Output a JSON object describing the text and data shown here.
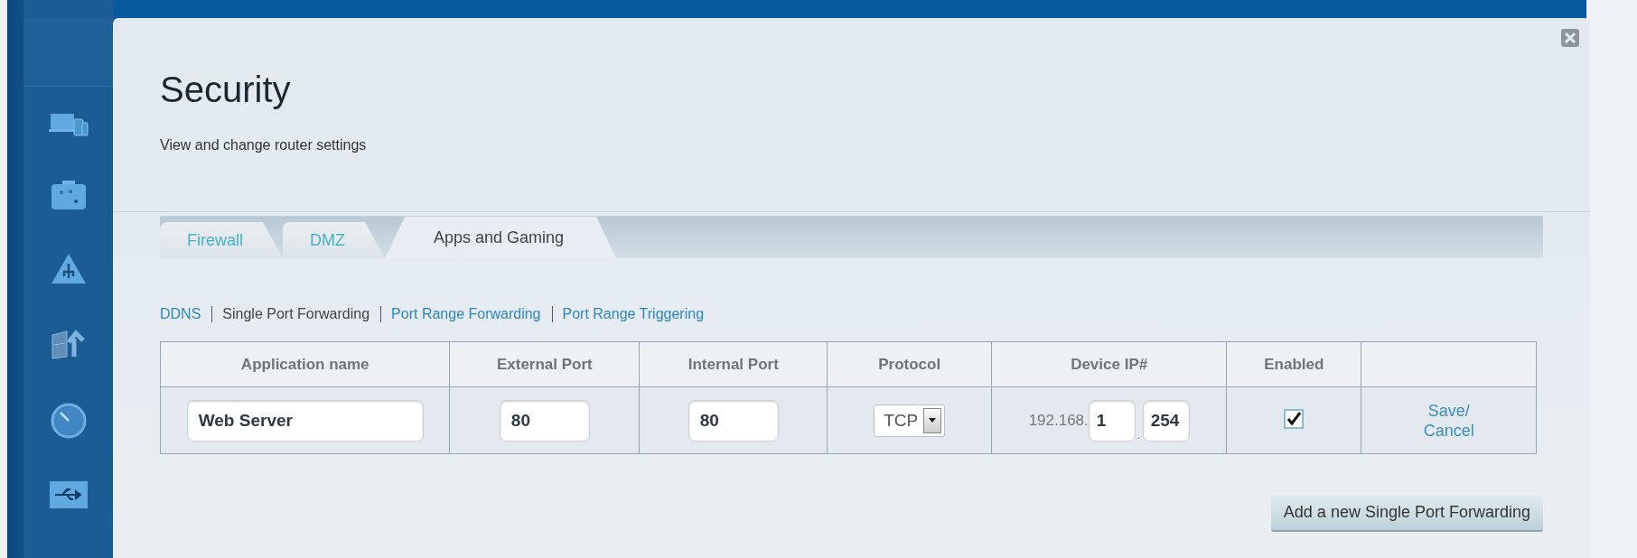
{
  "window": {
    "title": "Security",
    "subtitle": "View and change router settings"
  },
  "tabs": [
    {
      "label": "Firewall",
      "selected": false
    },
    {
      "label": "DMZ",
      "selected": false
    },
    {
      "label": "Apps and Gaming",
      "selected": true
    }
  ],
  "subtabs": [
    {
      "label": "DDNS",
      "selected": false
    },
    {
      "label": "Single Port Forwarding",
      "selected": true
    },
    {
      "label": "Port Range Forwarding",
      "selected": false
    },
    {
      "label": "Port Range Triggering",
      "selected": false
    }
  ],
  "table": {
    "columns": [
      "Application name",
      "External Port",
      "Internal Port",
      "Protocol",
      "Device IP#",
      "Enabled"
    ],
    "rows": [
      {
        "application_name": "Web Server",
        "external_port": "80",
        "internal_port": "80",
        "protocol": "TCP",
        "device_ip_prefix": "192.168.",
        "device_ip_part_3": "1",
        "device_ip_separator": ".",
        "device_ip_part_4": "254",
        "enabled": true,
        "actions": [
          "Save/",
          "Cancel"
        ]
      }
    ]
  },
  "add_button": "Add a new Single Port Forwarding"
}
